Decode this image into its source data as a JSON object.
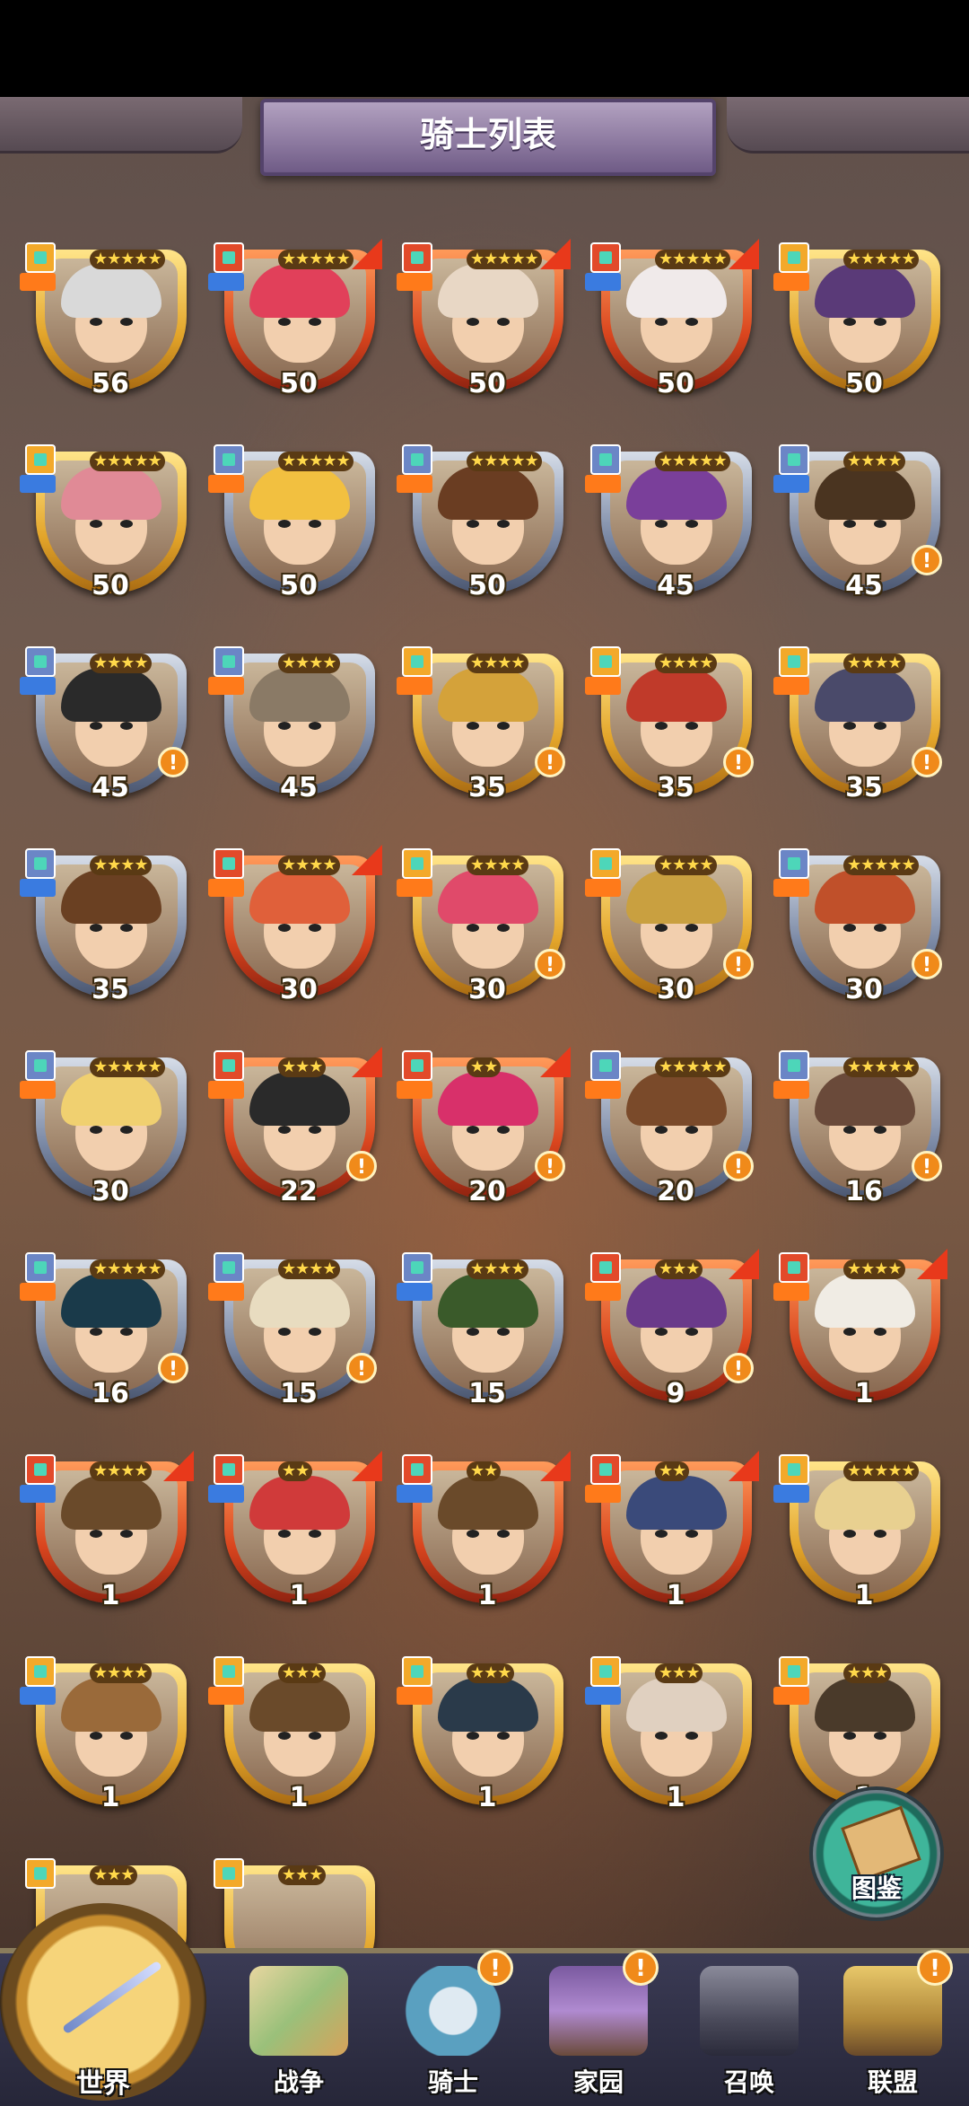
{
  "page_title": "骑士列表",
  "codex_label": "图鉴",
  "knights": [
    {
      "level": "56",
      "stars": "★★★★★",
      "frame": "gold",
      "hair": "#d9d9d9",
      "role_color": "#ff7a1a",
      "class_color": "#f3a92a",
      "upgrade": false,
      "alert": false
    },
    {
      "level": "50",
      "stars": "★★★★★",
      "frame": "red",
      "hair": "#e1405a",
      "role_color": "#3a7be0",
      "class_color": "#e24a2a",
      "upgrade": true,
      "alert": false
    },
    {
      "level": "50",
      "stars": "★★★★★",
      "frame": "red",
      "hair": "#e8d7c5",
      "role_color": "#ff7a1a",
      "class_color": "#e24a2a",
      "upgrade": true,
      "alert": false
    },
    {
      "level": "50",
      "stars": "★★★★★",
      "frame": "red",
      "hair": "#f0eaea",
      "role_color": "#3a7be0",
      "class_color": "#e24a2a",
      "upgrade": true,
      "alert": false
    },
    {
      "level": "50",
      "stars": "★★★★★",
      "frame": "gold",
      "hair": "#5a3a78",
      "role_color": "#ff7a1a",
      "class_color": "#f3a92a",
      "upgrade": false,
      "alert": false
    },
    {
      "level": "50",
      "stars": "★★★★★",
      "frame": "gold",
      "hair": "#e08a96",
      "role_color": "#3a7be0",
      "class_color": "#f3a92a",
      "upgrade": false,
      "alert": false
    },
    {
      "level": "50",
      "stars": "★★★★★",
      "frame": "blue",
      "hair": "#f2c040",
      "role_color": "#ff7a1a",
      "class_color": "#6b86c6",
      "upgrade": false,
      "alert": false
    },
    {
      "level": "50",
      "stars": "★★★★★",
      "frame": "blue",
      "hair": "#6a3d22",
      "role_color": "#ff7a1a",
      "class_color": "#6b86c6",
      "upgrade": false,
      "alert": false
    },
    {
      "level": "45",
      "stars": "★★★★★",
      "frame": "blue",
      "hair": "#7a3f9a",
      "role_color": "#ff7a1a",
      "class_color": "#6b86c6",
      "upgrade": false,
      "alert": false
    },
    {
      "level": "45",
      "stars": "★★★★",
      "frame": "blue",
      "hair": "#4a3420",
      "role_color": "#3a7be0",
      "class_color": "#6b86c6",
      "upgrade": false,
      "alert": true
    },
    {
      "level": "45",
      "stars": "★★★★",
      "frame": "blue",
      "hair": "#2a2a2a",
      "role_color": "#3a7be0",
      "class_color": "#6b86c6",
      "upgrade": false,
      "alert": true
    },
    {
      "level": "45",
      "stars": "★★★★",
      "frame": "blue",
      "hair": "#8a7a66",
      "role_color": "#ff7a1a",
      "class_color": "#6b86c6",
      "upgrade": false,
      "alert": false
    },
    {
      "level": "35",
      "stars": "★★★★",
      "frame": "gold",
      "hair": "#d4a23a",
      "role_color": "#ff7a1a",
      "class_color": "#f3a92a",
      "upgrade": false,
      "alert": true
    },
    {
      "level": "35",
      "stars": "★★★★",
      "frame": "gold",
      "hair": "#c03a2a",
      "role_color": "#ff7a1a",
      "class_color": "#f3a92a",
      "upgrade": false,
      "alert": true
    },
    {
      "level": "35",
      "stars": "★★★★",
      "frame": "gold",
      "hair": "#4a4a6a",
      "role_color": "#ff7a1a",
      "class_color": "#f3a92a",
      "upgrade": false,
      "alert": true
    },
    {
      "level": "35",
      "stars": "★★★★",
      "frame": "blue",
      "hair": "#6a4022",
      "role_color": "#3a7be0",
      "class_color": "#6b86c6",
      "upgrade": false,
      "alert": false
    },
    {
      "level": "30",
      "stars": "★★★★",
      "frame": "red",
      "hair": "#e0603a",
      "role_color": "#ff7a1a",
      "class_color": "#e24a2a",
      "upgrade": true,
      "alert": false
    },
    {
      "level": "30",
      "stars": "★★★★",
      "frame": "gold",
      "hair": "#e04a6a",
      "role_color": "#ff7a1a",
      "class_color": "#f3a92a",
      "upgrade": false,
      "alert": true
    },
    {
      "level": "30",
      "stars": "★★★★",
      "frame": "gold",
      "hair": "#c9a040",
      "role_color": "#ff7a1a",
      "class_color": "#f3a92a",
      "upgrade": false,
      "alert": true
    },
    {
      "level": "30",
      "stars": "★★★★★",
      "frame": "blue",
      "hair": "#c0502a",
      "role_color": "#ff7a1a",
      "class_color": "#6b86c6",
      "upgrade": false,
      "alert": true
    },
    {
      "level": "30",
      "stars": "★★★★★",
      "frame": "blue",
      "hair": "#f0d070",
      "role_color": "#ff7a1a",
      "class_color": "#6b86c6",
      "upgrade": false,
      "alert": false
    },
    {
      "level": "22",
      "stars": "★★★",
      "frame": "red",
      "hair": "#2a2a2a",
      "role_color": "#ff7a1a",
      "class_color": "#e24a2a",
      "upgrade": true,
      "alert": true
    },
    {
      "level": "20",
      "stars": "★★",
      "frame": "red",
      "hair": "#d8306a",
      "role_color": "#ff7a1a",
      "class_color": "#e24a2a",
      "upgrade": true,
      "alert": true
    },
    {
      "level": "20",
      "stars": "★★★★★",
      "frame": "blue",
      "hair": "#7a4a2a",
      "role_color": "#ff7a1a",
      "class_color": "#6b86c6",
      "upgrade": false,
      "alert": true
    },
    {
      "level": "16",
      "stars": "★★★★★",
      "frame": "blue",
      "hair": "#6a4a3a",
      "role_color": "#ff7a1a",
      "class_color": "#6b86c6",
      "upgrade": false,
      "alert": true
    },
    {
      "level": "16",
      "stars": "★★★★★",
      "frame": "blue",
      "hair": "#1a3a4a",
      "role_color": "#ff7a1a",
      "class_color": "#6b86c6",
      "upgrade": false,
      "alert": true
    },
    {
      "level": "15",
      "stars": "★★★★",
      "frame": "blue",
      "hair": "#e8dcc0",
      "role_color": "#ff7a1a",
      "class_color": "#6b86c6",
      "upgrade": false,
      "alert": true
    },
    {
      "level": "15",
      "stars": "★★★★",
      "frame": "blue",
      "hair": "#3a5a2a",
      "role_color": "#3a7be0",
      "class_color": "#6b86c6",
      "upgrade": false,
      "alert": false
    },
    {
      "level": "9",
      "stars": "★★★",
      "frame": "red",
      "hair": "#6a3a8a",
      "role_color": "#ff7a1a",
      "class_color": "#e24a2a",
      "upgrade": true,
      "alert": true
    },
    {
      "level": "1",
      "stars": "★★★★",
      "frame": "red",
      "hair": "#f0ece4",
      "role_color": "#ff7a1a",
      "class_color": "#e24a2a",
      "upgrade": true,
      "alert": false
    },
    {
      "level": "1",
      "stars": "★★★★",
      "frame": "red",
      "hair": "#6a4a2a",
      "role_color": "#3a7be0",
      "class_color": "#e24a2a",
      "upgrade": true,
      "alert": false
    },
    {
      "level": "1",
      "stars": "★★",
      "frame": "red",
      "hair": "#d03a3a",
      "role_color": "#3a7be0",
      "class_color": "#e24a2a",
      "upgrade": true,
      "alert": false
    },
    {
      "level": "1",
      "stars": "★★",
      "frame": "red",
      "hair": "#6a4a2a",
      "role_color": "#3a7be0",
      "class_color": "#e24a2a",
      "upgrade": true,
      "alert": false
    },
    {
      "level": "1",
      "stars": "★★",
      "frame": "red",
      "hair": "#3a4a7a",
      "role_color": "#ff7a1a",
      "class_color": "#e24a2a",
      "upgrade": true,
      "alert": false
    },
    {
      "level": "1",
      "stars": "★★★★★",
      "frame": "gold",
      "hair": "#e8d090",
      "role_color": "#3a7be0",
      "class_color": "#f3a92a",
      "upgrade": false,
      "alert": false
    },
    {
      "level": "1",
      "stars": "★★★★",
      "frame": "gold",
      "hair": "#9a6a3a",
      "role_color": "#3a7be0",
      "class_color": "#f3a92a",
      "upgrade": false,
      "alert": false
    },
    {
      "level": "1",
      "stars": "★★★",
      "frame": "gold",
      "hair": "#6a4a2a",
      "role_color": "#ff7a1a",
      "class_color": "#f3a92a",
      "upgrade": false,
      "alert": false
    },
    {
      "level": "1",
      "stars": "★★★",
      "frame": "gold",
      "hair": "#2a3a4a",
      "role_color": "#ff7a1a",
      "class_color": "#f3a92a",
      "upgrade": false,
      "alert": false
    },
    {
      "level": "1",
      "stars": "★★★",
      "frame": "gold",
      "hair": "#e0d0c0",
      "role_color": "#3a7be0",
      "class_color": "#f3a92a",
      "upgrade": false,
      "alert": false
    },
    {
      "level": "1",
      "stars": "★★★",
      "frame": "gold",
      "hair": "#4a3a2a",
      "role_color": "#ff7a1a",
      "class_color": "#f3a92a",
      "upgrade": false,
      "alert": false
    }
  ],
  "partial_row": [
    {
      "stars": "★★★",
      "frame": "gold",
      "class_color": "#f3a92a"
    },
    {
      "stars": "★★★",
      "frame": "gold",
      "class_color": "#f3a92a"
    }
  ],
  "nav": {
    "world": "世界",
    "war": "战争",
    "knights": "骑士",
    "home": "家园",
    "summon": "召唤",
    "alliance": "联盟",
    "alert_symbol": "!"
  },
  "nav_alerts": {
    "knights": true,
    "home": true,
    "summon": false,
    "alliance": true
  }
}
